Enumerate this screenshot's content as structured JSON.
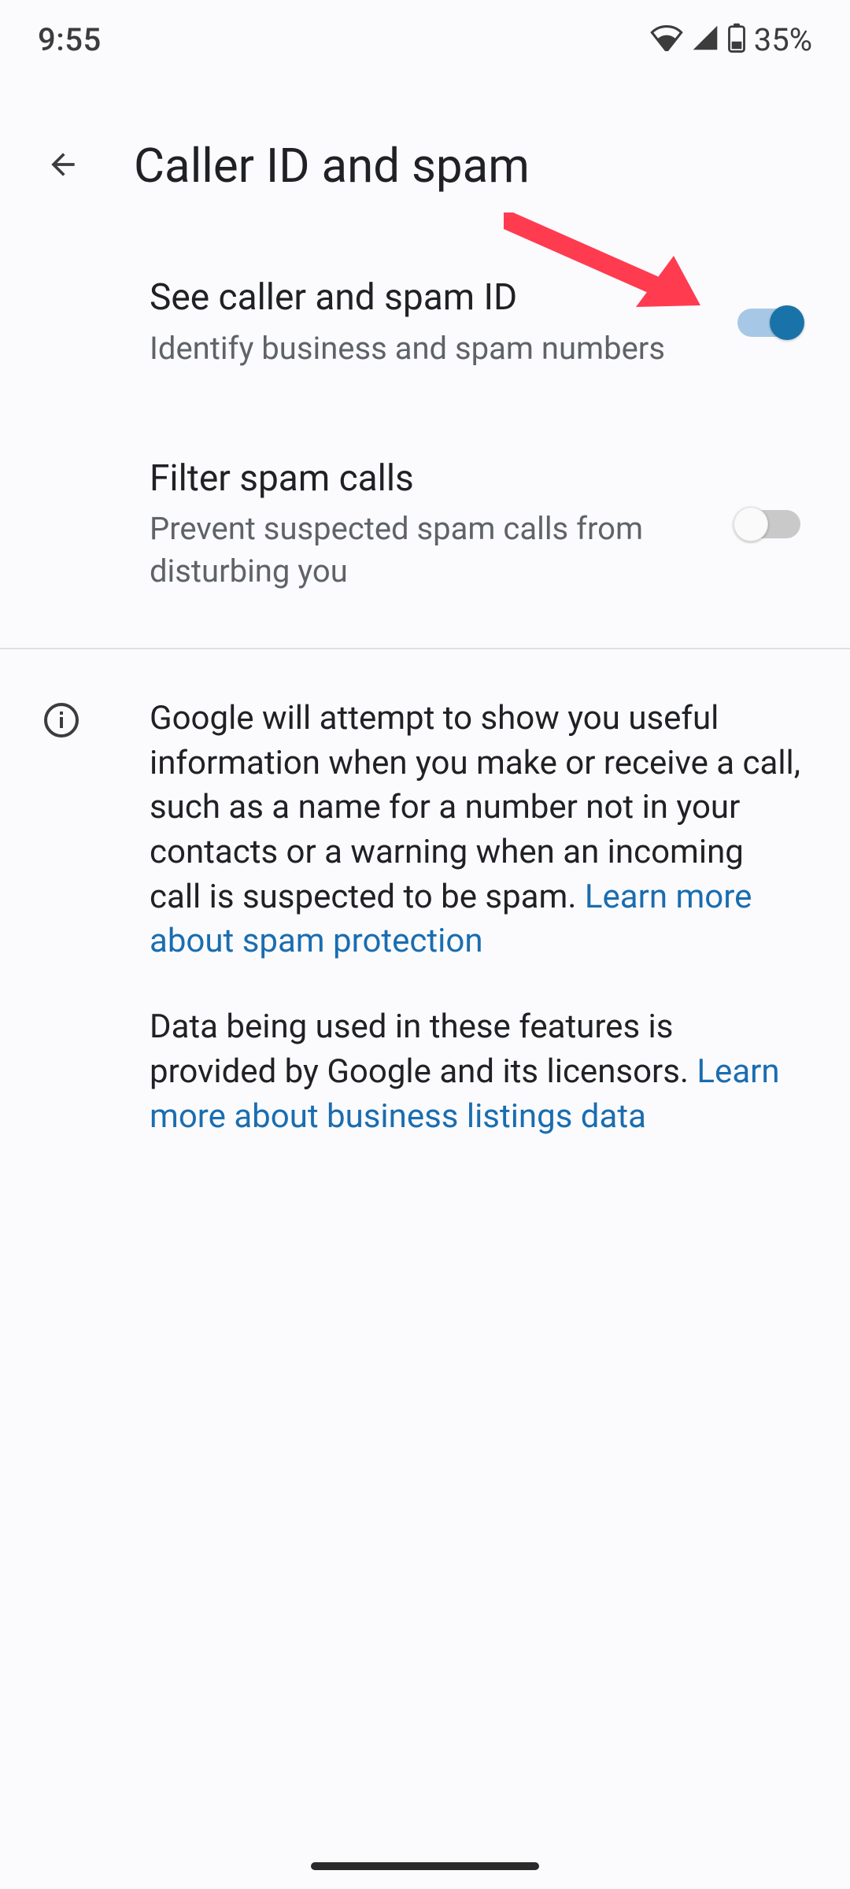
{
  "status_bar": {
    "time": "9:55",
    "battery_percent": "35%"
  },
  "header": {
    "title": "Caller ID and spam"
  },
  "settings": [
    {
      "title": "See caller and spam ID",
      "subtitle": "Identify business and spam numbers",
      "enabled": true
    },
    {
      "title": "Filter spam calls",
      "subtitle": "Prevent suspected spam calls from disturbing you",
      "enabled": false
    }
  ],
  "info": {
    "para1_a": "Google will attempt to show you useful information when you make or receive a call, such as a name for a number not in your contacts or a warning when an incoming call is suspected to be spam. ",
    "link1": "Learn more about spam protection",
    "para2_a": "Data being used in these features is provided by Google and its licensors. ",
    "link2": "Learn more about business listings data"
  },
  "annotation": {
    "type": "arrow",
    "color": "#ff3b50"
  }
}
